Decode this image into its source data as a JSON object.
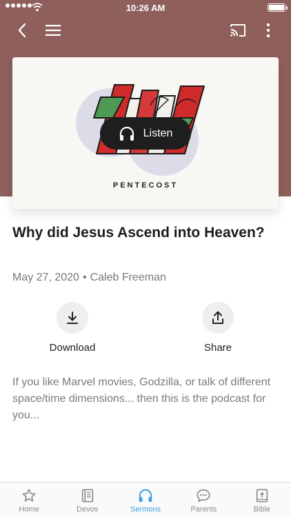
{
  "status_bar": {
    "time": "10:26 AM"
  },
  "toolbar": {
    "back_icon": "chevron-left-icon",
    "menu_icon": "hamburger-menu-icon",
    "cast_icon": "cast-icon",
    "more_icon": "more-vertical-icon"
  },
  "artwork": {
    "caption": "PENTECOST",
    "listen_label": "Listen",
    "listen_icon": "headphones-icon"
  },
  "sermon": {
    "title": "Why did Jesus Ascend into Heaven?",
    "date": "May 27, 2020",
    "separator": "•",
    "speaker": "Caleb Freeman",
    "description": "If you like Marvel movies, Godzilla, or talk of different space/time dimensions... then this is the podcast for you..."
  },
  "actions": {
    "download_label": "Download",
    "share_label": "Share"
  },
  "tabs": [
    {
      "label": "Home",
      "icon": "star-icon",
      "active": false
    },
    {
      "label": "Devos",
      "icon": "book-icon",
      "active": false
    },
    {
      "label": "Sermons",
      "icon": "headphones-icon",
      "active": true
    },
    {
      "label": "Parents",
      "icon": "chat-bubble-icon",
      "active": false
    },
    {
      "label": "Bible",
      "icon": "bible-icon",
      "active": false
    }
  ],
  "colors": {
    "header": "#8f5f5b",
    "active_tab": "#3aa0e0",
    "listen_button": "#1e1e1e"
  }
}
